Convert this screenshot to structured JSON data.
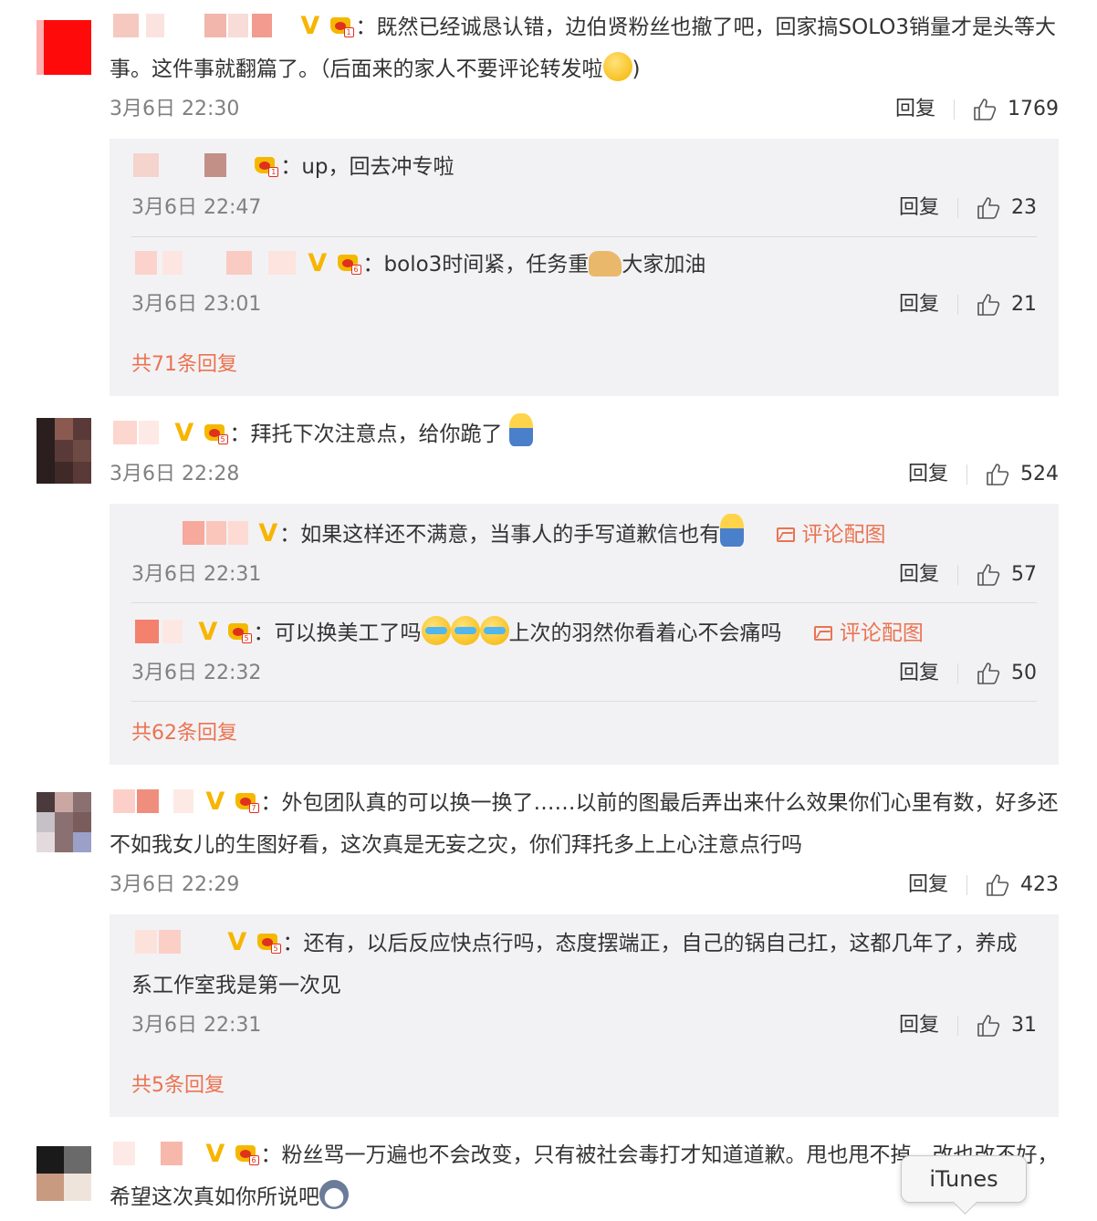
{
  "labels": {
    "reply": "回复",
    "view_picture": "评论配图"
  },
  "comments": [
    {
      "text": "既然已经诚恳认错，边伯贤粉丝也撤了吧，回家搞SOLO3销量才是头等大事。这件事就翻篇了。（后面来的家人不要评论转发啦",
      "text_end": ")",
      "time": "3月6日 22:30",
      "likes": "1769",
      "replies": [
        {
          "text": "up，回去冲专啦",
          "time": "3月6日 22:47",
          "likes": "23"
        },
        {
          "text_a": "bolo3时间紧，任务重",
          "text_b": "大家加油",
          "time": "3月6日 23:01",
          "likes": "21"
        }
      ],
      "more": "共71条回复"
    },
    {
      "text": "拜托下次注意点，给你跪了",
      "time": "3月6日 22:28",
      "likes": "524",
      "replies": [
        {
          "text": "如果这样还不满意，当事人的手写道歉信也有",
          "time": "3月6日 22:31",
          "likes": "57"
        },
        {
          "text_a": "可以换美工了吗",
          "text_b": "上次的羽然你看着心不会痛吗",
          "time": "3月6日 22:32",
          "likes": "50"
        }
      ],
      "more": "共62条回复"
    },
    {
      "text": "外包团队真的可以换一换了……以前的图最后弄出来什么效果你们心里有数，好多还不如我女儿的生图好看，这次真是无妄之灾，你们拜托多上上心注意点行吗",
      "time": "3月6日 22:29",
      "likes": "423",
      "replies": [
        {
          "text": "还有，以后反应快点行吗，态度摆端正，自己的锅自己扛，这都几年了，养成系工作室我是第一次见",
          "time": "3月6日 22:31",
          "likes": "31"
        }
      ],
      "more": "共5条回复"
    },
    {
      "text": "粉丝骂一万遍也不会改变，只有被社会毒打才知道道歉。甩也甩不掉，改也改不好，希望这次真如你所说吧"
    }
  ],
  "tooltip": "iTunes",
  "colors": {
    "link": "#eb7350",
    "vip": "#f7b500",
    "panel": "#f2f2f5",
    "meta": "#808080"
  }
}
